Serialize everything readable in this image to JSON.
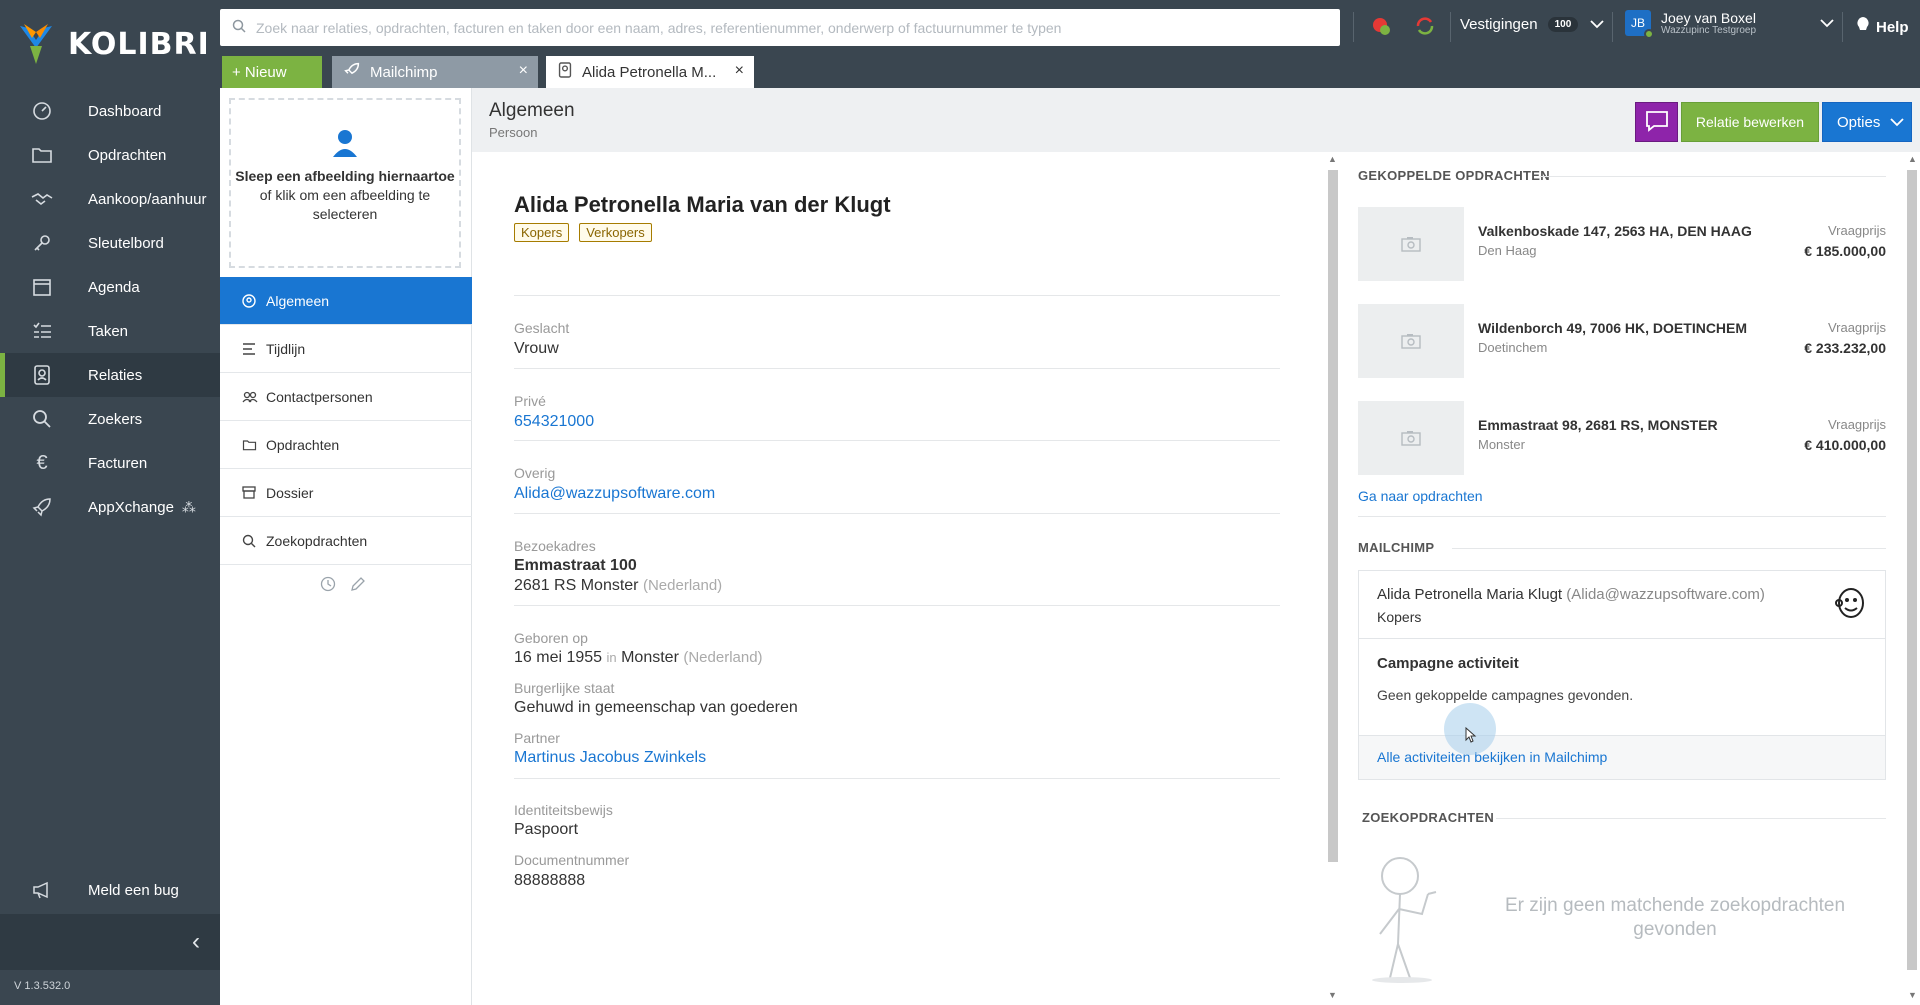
{
  "app": {
    "logo_text": "KOLIBRI",
    "version": "V 1.3.532.0",
    "colors": {
      "sidebar": "#3a4650",
      "accent_green": "#7cb342",
      "accent_blue": "#1976d2",
      "tag_border": "#a67c00",
      "chat_purple": "#8e24aa"
    }
  },
  "sidebar": {
    "items": [
      {
        "label": "Dashboard",
        "icon": "dashboard-icon"
      },
      {
        "label": "Opdrachten",
        "icon": "folder-icon"
      },
      {
        "label": "Aankoop/aanhuur",
        "icon": "handshake-icon"
      },
      {
        "label": "Sleutelbord",
        "icon": "key-icon"
      },
      {
        "label": "Agenda",
        "icon": "calendar-icon"
      },
      {
        "label": "Taken",
        "icon": "tasks-icon"
      },
      {
        "label": "Relaties",
        "icon": "contact-icon",
        "active": true
      },
      {
        "label": "Zoekers",
        "icon": "search-icon"
      },
      {
        "label": "Facturen",
        "icon": "euro-icon"
      },
      {
        "label": "AppXchange",
        "icon": "rocket-icon"
      }
    ],
    "bug_label": "Meld een bug"
  },
  "topbar": {
    "search_placeholder": "Zoek naar relaties, opdrachten, facturen en taken door een naam, adres, referentienummer, onderwerp of factuurnummer te typen",
    "vestigingen_label": "Vestigingen",
    "vestigingen_count": "100",
    "user_initials": "JB",
    "user_name": "Joey van Boxel",
    "user_org": "Wazzupinc Testgroep",
    "help_label": "Help"
  },
  "tabs": {
    "new_label": "+ Nieuw",
    "items": [
      {
        "label": "Mailchimp",
        "active": false
      },
      {
        "label": "Alida Petronella M...",
        "active": true
      }
    ]
  },
  "subpanel": {
    "dropzone_bold": "Sleep een afbeelding hiernaartoe",
    "dropzone_light": "of klik om een afbeelding te selecteren",
    "menu": [
      {
        "label": "Algemeen",
        "active": true
      },
      {
        "label": "Tijdlijn"
      },
      {
        "label": "Contactpersonen"
      },
      {
        "label": "Opdrachten"
      },
      {
        "label": "Dossier"
      },
      {
        "label": "Zoekopdrachten"
      }
    ]
  },
  "header": {
    "title": "Algemeen",
    "subtitle": "Persoon",
    "edit_label": "Relatie bewerken",
    "options_label": "Opties"
  },
  "person": {
    "name": "Alida Petronella Maria van der Klugt",
    "tags": [
      "Kopers",
      "Verkopers"
    ],
    "gender_label": "Geslacht",
    "gender": "Vrouw",
    "private_label": "Privé",
    "phone": "654321000",
    "other_label": "Overig",
    "email": "Alida@wazzupsoftware.com",
    "address_label": "Bezoekadres",
    "street": "Emmastraat 100",
    "postal_city": "2681 RS Monster",
    "country": "(Nederland)",
    "born_label": "Geboren op",
    "born_date": "16 mei 1955",
    "born_in": "in",
    "born_place": "Monster",
    "born_country": "(Nederland)",
    "civil_label": "Burgerlijke staat",
    "civil": "Gehuwd in gemeenschap van goederen",
    "partner_label": "Partner",
    "partner": "Martinus Jacobus Zwinkels",
    "id_label": "Identiteitsbewijs",
    "id": "Paspoort",
    "docnr_label": "Documentnummer",
    "docnr": "88888888"
  },
  "right": {
    "opdrachten_title": "GEKOPPELDE OPDRACHTEN",
    "properties": [
      {
        "address": "Valkenboskade 147, 2563 HA, DEN HAAG",
        "city": "Den Haag",
        "price_label": "Vraagprijs",
        "price": "€ 185.000,00"
      },
      {
        "address": "Wildenborch 49, 7006 HK, DOETINCHEM",
        "city": "Doetinchem",
        "price_label": "Vraagprijs",
        "price": "€ 233.232,00"
      },
      {
        "address": "Emmastraat 98, 2681 RS, MONSTER",
        "city": "Monster",
        "price_label": "Vraagprijs",
        "price": "€ 410.000,00"
      }
    ],
    "goto_link": "Ga naar opdrachten",
    "mailchimp_title": "MAILCHIMP",
    "mc_name": "Alida Petronella Maria Klugt",
    "mc_email": "(Alida@wazzupsoftware.com)",
    "mc_list": "Kopers",
    "campaign_title": "Campagne activiteit",
    "campaign_text": "Geen gekoppelde campagnes gevonden.",
    "mc_link": "Alle activiteiten bekijken in Mailchimp",
    "zoek_title": "ZOEKOPDRACHTEN",
    "empty_text": "Er zijn geen matchende zoekopdrachten gevonden"
  }
}
